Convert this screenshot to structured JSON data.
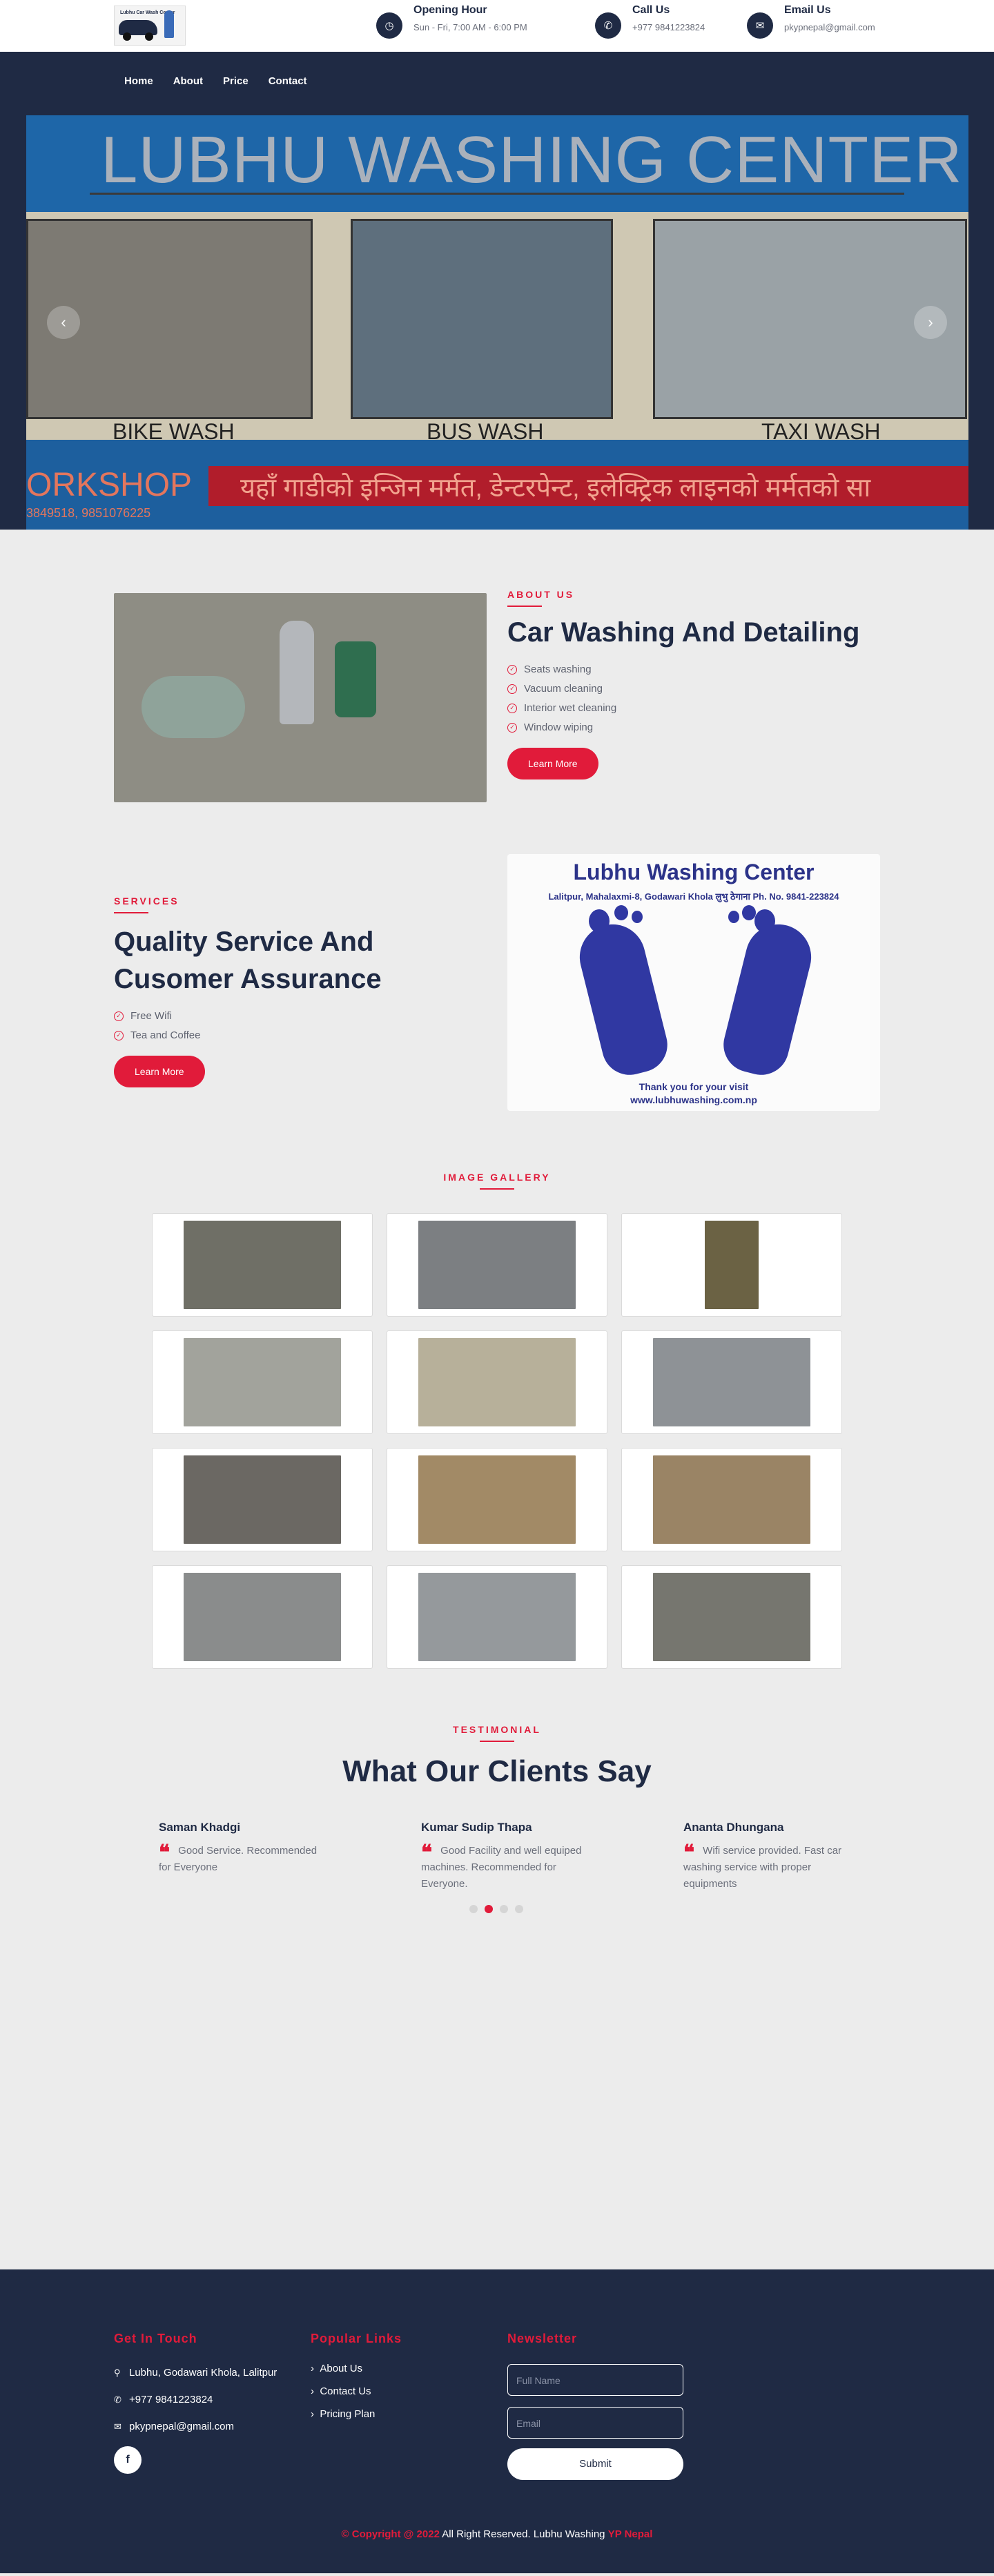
{
  "header": {
    "logo_text": "Lubhu Car Wash Center",
    "opening": {
      "title": "Opening Hour",
      "text": "Sun - Fri, 7:00 AM - 6:00 PM"
    },
    "call": {
      "title": "Call Us",
      "text": "+977 9841223824"
    },
    "email": {
      "title": "Email Us",
      "text": "pkypnepal@gmail.com"
    }
  },
  "nav": {
    "items": [
      "Home",
      "About",
      "Price",
      "Contact"
    ]
  },
  "hero": {
    "title": "LUBHU WASHING CENTER",
    "captions": [
      "BIKE WASH",
      "BUS WASH",
      "TAXI WASH"
    ],
    "ticker": "यहाँ गाडीको इन्जिन मर्मत, डेन्टरपेन्ट, इलेक्ट्रिक लाइनको मर्मतको सा",
    "workshop": "ORKSHOP",
    "phones": "3849518, 9851076225",
    "prev_icon": "chevron-left-icon",
    "next_icon": "chevron-right-icon"
  },
  "about": {
    "label": "ABOUT US",
    "heading": "Car Washing And Detailing",
    "items": [
      "Seats washing",
      "Vacuum cleaning",
      "Interior wet cleaning",
      "Window wiping"
    ],
    "button": "Learn More"
  },
  "services": {
    "label": "SERVICES",
    "heading": "Quality Service And Cusomer Assurance",
    "items": [
      "Free Wifi",
      "Tea and Coffee"
    ],
    "button": "Learn More",
    "card": {
      "title": "Lubhu Washing Center",
      "subtitle": "Lalitpur, Mahalaxmi-8, Godawari Khola लुभु ठेगाना Ph. No. 9841-223824",
      "thanks": "Thank you for your visit",
      "website": "www.lubhuwashing.com.np"
    }
  },
  "gallery": {
    "label": "IMAGE GALLERY",
    "tiles": [
      "#6f6f66",
      "#7c7f82",
      "#6b6244",
      "#a2a39c",
      "#b7b09a",
      "#8e9296",
      "#6b6863",
      "#a28a66",
      "#9a8465",
      "#8a8c8c",
      "#95999c",
      "#76766f"
    ]
  },
  "testimonial": {
    "label": "TESTIMONIAL",
    "heading": "What Our Clients Say",
    "items": [
      {
        "name": "Saman Khadgi",
        "quote": "Good Service. Recommended for Everyone"
      },
      {
        "name": "Kumar Sudip Thapa",
        "quote": "Good Facility and well equiped machines. Recommended for Everyone."
      },
      {
        "name": "Ananta Dhungana",
        "quote": "Wifi service provided. Fast car washing service with proper equipments"
      }
    ]
  },
  "footer": {
    "touch": {
      "title": "Get In Touch",
      "address": "Lubhu, Godawari Khola, Lalitpur",
      "phone": "+977 9841223824",
      "email": "pkypnepal@gmail.com",
      "social": "f"
    },
    "links": {
      "title": "Popular Links",
      "items": [
        "About Us",
        "Contact Us",
        "Pricing Plan"
      ]
    },
    "newsletter": {
      "title": "Newsletter",
      "name_placeholder": "Full Name",
      "email_placeholder": "Email",
      "submit": "Submit"
    },
    "copyright": {
      "left": "© Copyright @ 2022",
      "middle": " All Right Reserved. Lubhu Washing ",
      "right": "YP Nepal"
    }
  },
  "colors": {
    "navy": "#1f2a44",
    "accent": "#e11b3a",
    "background": "#ececec"
  }
}
